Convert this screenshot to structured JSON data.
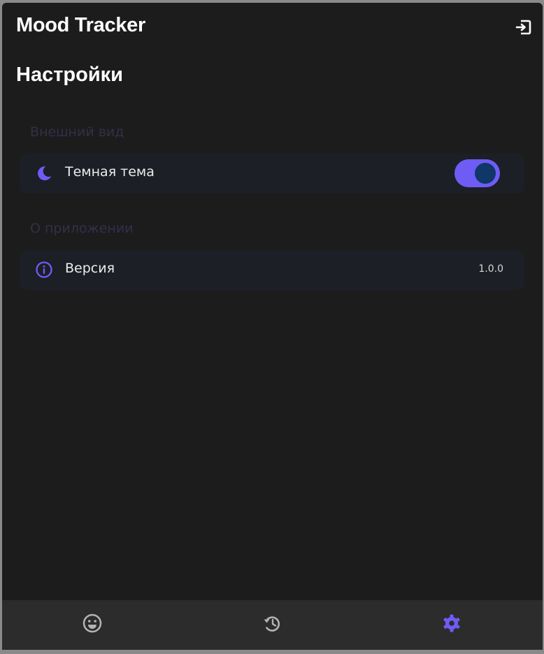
{
  "app": {
    "title": "Mood Tracker"
  },
  "page": {
    "title": "Настройки"
  },
  "sections": {
    "appearance": {
      "header": "Внешний вид",
      "dark_theme": {
        "label": "Темная тема",
        "icon": "moon-icon",
        "enabled": true
      }
    },
    "about": {
      "header": "О приложении",
      "version": {
        "label": "Версия",
        "icon": "info-icon",
        "value": "1.0.0"
      }
    }
  },
  "bottom_nav": {
    "items": [
      {
        "icon": "smiley-icon",
        "active": false
      },
      {
        "icon": "history-icon",
        "active": false
      },
      {
        "icon": "gear-icon",
        "active": true
      }
    ]
  },
  "colors": {
    "background": "#1c1c1c",
    "card": "#1c1f26",
    "accent": "#6f5cf5",
    "toggle_knob": "#0f3768",
    "nav_background": "#2c2c2c",
    "nav_inactive": "#b4b4b4"
  }
}
